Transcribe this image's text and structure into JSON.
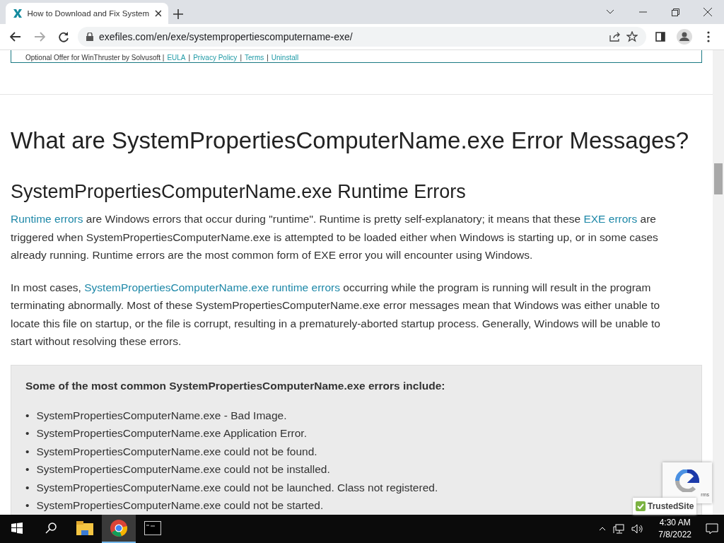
{
  "browser": {
    "tab": {
      "title": "How to Download and Fix System",
      "selected": true
    },
    "url": "exefiles.com/en/exe/systempropertiescomputername-exe/"
  },
  "offer": {
    "text": "Optional Offer for WinThruster by Solvusoft |",
    "links": [
      {
        "label": "EULA"
      },
      {
        "separator": "|",
        "label": "Privacy Policy"
      },
      {
        "separator": "|",
        "label": "Terms"
      },
      {
        "separator": "|",
        "label": "Uninstall"
      }
    ]
  },
  "article": {
    "title": "What are SystemPropertiesComputerName.exe Error Messages?",
    "section_title": "SystemPropertiesComputerName.exe Runtime Errors",
    "paragraphs": [
      [
        {
          "text": "Runtime errors",
          "link": true
        },
        {
          "text": " are Windows errors that occur during \"runtime\". Runtime is pretty self-explanatory; it means that these ",
          "link": false
        },
        {
          "text": "EXE errors",
          "link": true
        },
        {
          "text": " are triggered when SystemPropertiesComputerName.exe is attempted to be loaded either when Windows is starting up, or in some cases already running. Runtime errors are the most common form of EXE error you will encounter using Windows.",
          "link": false
        }
      ],
      [
        {
          "text": "In most cases, ",
          "link": false
        },
        {
          "text": "SystemPropertiesComputerName.exe runtime errors",
          "link": true
        },
        {
          "text": " occurring while the program is running will result in the program terminating abnormally. Most of these SystemPropertiesComputerName.exe error messages mean that Windows was either unable to locate this file on startup, or the file is corrupt, resulting in a prematurely-aborted startup process. Generally, Windows will be unable to start without resolving these errors.",
          "link": false
        }
      ]
    ],
    "errors_box": {
      "heading": "Some of the most common SystemPropertiesComputerName.exe errors include:",
      "items": [
        {
          "bullet": "•",
          "text": "SystemPropertiesComputerName.exe - Bad Image."
        },
        {
          "bullet": "•",
          "text": "SystemPropertiesComputerName.exe Application Error."
        },
        {
          "bullet": "•",
          "text": "SystemPropertiesComputerName.exe could not be found."
        },
        {
          "bullet": "•",
          "text": "SystemPropertiesComputerName.exe could not be installed."
        },
        {
          "bullet": "•",
          "text": "SystemPropertiesComputerName.exe could not be launched. Class not registered."
        },
        {
          "bullet": "•",
          "text": "SystemPropertiesComputerName.exe could not be started."
        }
      ]
    }
  },
  "recaptcha": {
    "text": "rms"
  },
  "trusted_badge": {
    "label": "TrustedSite"
  },
  "taskbar": {
    "apps": [
      {
        "kind": "explorer",
        "selected": false
      },
      {
        "kind": "chrome",
        "selected": true
      },
      {
        "kind": "terminal",
        "selected": false
      }
    ],
    "time": "4:30 AM",
    "date": "7/8/2022"
  }
}
